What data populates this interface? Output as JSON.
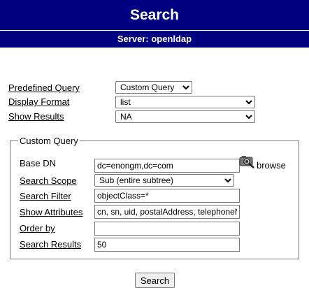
{
  "header": {
    "title": "Search"
  },
  "server": {
    "prefix": "Server:",
    "name": "openldap"
  },
  "form": {
    "predefined_query": {
      "label": "Predefined Query",
      "value": "Custom Query"
    },
    "display_format": {
      "label": "Display Format",
      "value": "list"
    },
    "show_results": {
      "label": "Show Results",
      "value": "NA"
    }
  },
  "custom_query": {
    "legend": "Custom Query",
    "base_dn": {
      "label": "Base DN",
      "value": "dc=enongm,dc=com"
    },
    "browse": {
      "label": "browse",
      "icon": "browse-icon"
    },
    "search_scope": {
      "label": "Search Scope",
      "value": "Sub (entire subtree)"
    },
    "search_filter": {
      "label": "Search Filter",
      "value": "objectClass=*"
    },
    "show_attributes": {
      "label": "Show Attributes",
      "value": "cn, sn, uid, postalAddress, telephoneNumber"
    },
    "order_by": {
      "label": "Order by",
      "value": ""
    },
    "search_results": {
      "label": "Search Results",
      "value": "50"
    }
  },
  "search_button": {
    "label": "Search"
  },
  "colors": {
    "header_bg": "#000080",
    "header_text": "#ffffff"
  }
}
